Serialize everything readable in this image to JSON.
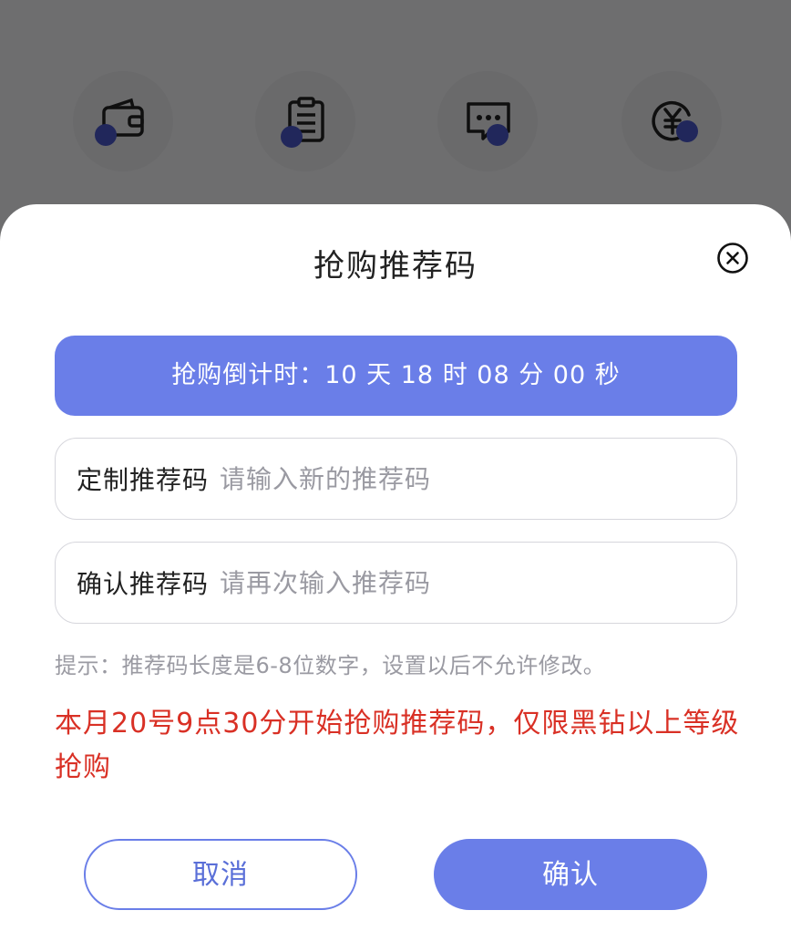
{
  "background": {
    "icons": [
      {
        "name": "wallet-icon"
      },
      {
        "name": "clipboard-icon"
      },
      {
        "name": "chat-icon"
      },
      {
        "name": "yuan-coin-icon"
      }
    ]
  },
  "dialog": {
    "title": "抢购推荐码",
    "countdown": "抢购倒计时：10 天 18 时 08 分 00 秒",
    "custom_code": {
      "label": "定制推荐码",
      "placeholder": "请输入新的推荐码",
      "value": ""
    },
    "confirm_code": {
      "label": "确认推荐码",
      "placeholder": "请再次输入推荐码",
      "value": ""
    },
    "hint": "提示：推荐码长度是6-8位数字，设置以后不允许修改。",
    "notice": "本月20号9点30分开始抢购推荐码，仅限黑钻以上等级抢购",
    "cancel_label": "取消",
    "confirm_label": "确认"
  },
  "colors": {
    "accent": "#6a7ee8",
    "notice": "#d93025",
    "hint": "#9a9aa2"
  }
}
